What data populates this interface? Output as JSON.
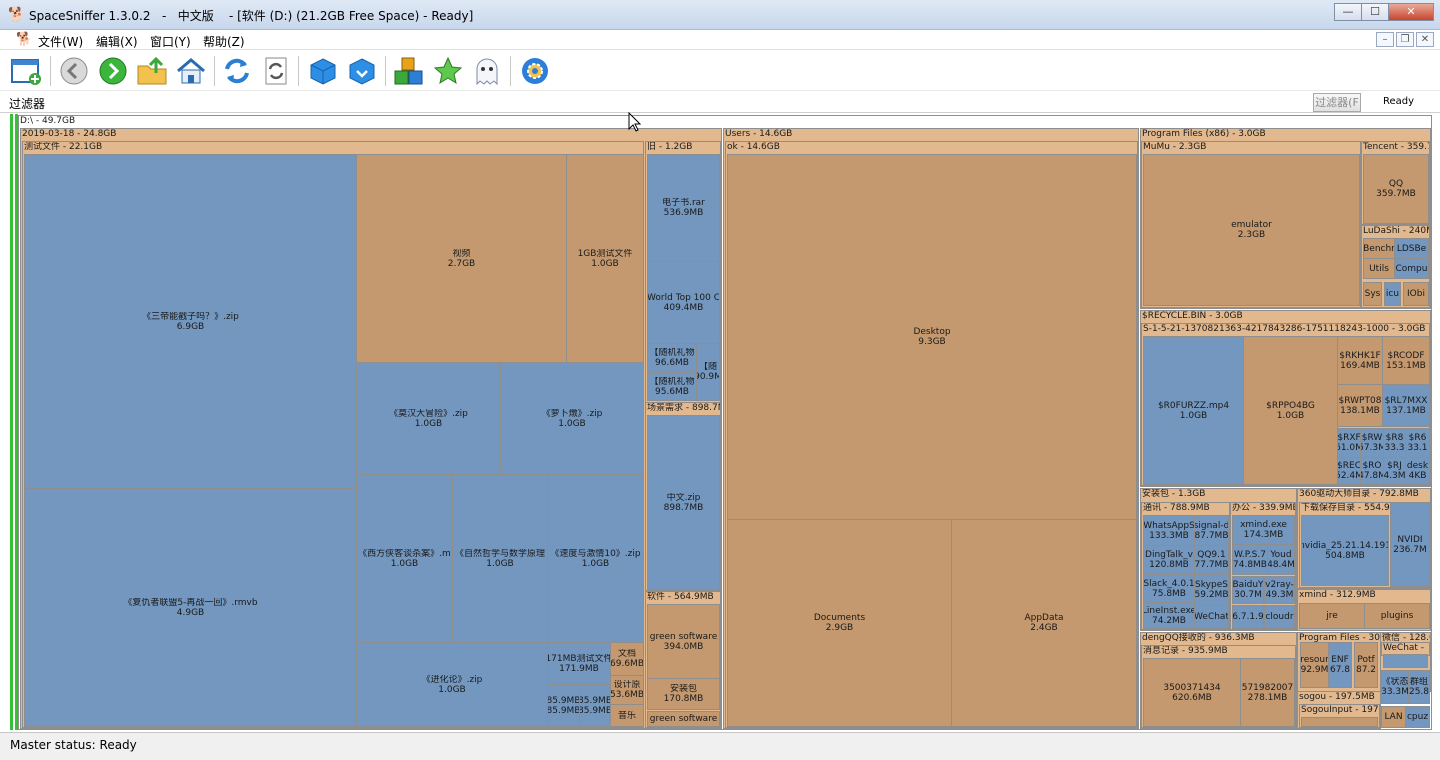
{
  "window": {
    "title": "SpaceSniffer 1.3.0.2   -   中文版    - [软件 (D:) (21.2GB Free Space) - Ready]",
    "icon": "sniffer-dog-icon",
    "buttons": {
      "minimize": "—",
      "maximize": "☐",
      "close": "✕"
    }
  },
  "menu": {
    "items": [
      "文件(W)",
      "编辑(X)",
      "窗口(Y)",
      "帮助(Z)"
    ],
    "mdi_buttons": {
      "minimize": "–",
      "restore": "❐",
      "close": "✕"
    }
  },
  "toolbar": {
    "buttons": [
      "new-view-icon",
      "back-icon",
      "forward-icon",
      "parent-folder-icon",
      "home-icon",
      "refresh-icon",
      "refresh-branch-icon",
      "zoom-in-icon",
      "zoom-out-icon",
      "tags-icon",
      "star-icon",
      "ghost-icon",
      "settings-icon"
    ]
  },
  "filter": {
    "label": "过滤器",
    "value": "",
    "button_label": "过滤器(F",
    "status": "Ready"
  },
  "colors": {
    "folder": "#c4996f",
    "file": "#7397bf",
    "header": "#e2b88e",
    "green": "#34c134"
  },
  "treemap": {
    "root": {
      "label": "D:\\ - 49.7GB"
    },
    "groups": {
      "g2019": "2019-03-18 - 24.8GB",
      "test": "测试文件 - 22.1GB",
      "old": "旧 - 1.2GB",
      "scene": "场景需求 - 898.7M",
      "soft": "软件 - 564.9MB",
      "users": "Users - 14.6GB",
      "ok": "ok - 14.6GB",
      "pf86": "Program Files (x86) - 3.0GB",
      "mumu": "MuMu - 2.3GB",
      "tencent": "Tencent - 359.7",
      "ludashi": "LuDaShi - 240M",
      "recycle": "$RECYCLE.BIN - 3.0GB",
      "sid": "S-1-5-21-1370821363-4217843286-1751118243-1000 - 3.0GB",
      "install": "安装包 - 1.3GB",
      "comm": "通讯 - 788.9MB",
      "office": "办公 - 339.9MB",
      "driver360": "360驱动大师目录 - 792.8MB",
      "dlcache": "下载保存目录 - 554.9",
      "xmind": "xmind - 312.9MB",
      "dengqq": "dengQQ接收的 - 936.3MB",
      "msglog": "消息记录 - 935.9MB",
      "progfiles": "Program Files - 30€",
      "wechatdir": "微信 - 128.6",
      "sogou": "sogou - 197.5MB",
      "sogouinput": "SogouInput - 197."
    },
    "items": {
      "sanguo": {
        "name": "《三帝能戳子吗？》.zip",
        "size": "6.9GB"
      },
      "fuchou": {
        "name": "《复仇者联盟5-再战一回》.rmvb",
        "size": "4.9GB"
      },
      "video": {
        "name": "视频",
        "size": "2.7GB"
      },
      "test1g": {
        "name": "1GB测试文件",
        "size": "1.0GB"
      },
      "hanhan": {
        "name": "《莫汉大冒险》.zip",
        "size": "1.0GB"
      },
      "luobo": {
        "name": "《萝卜燉》.zip",
        "size": "1.0GB"
      },
      "xifang": {
        "name": "《西方侠客谈杀案》.m",
        "size": "1.0GB"
      },
      "ziran": {
        "name": "《自然哲学与数学原理",
        "size": "1.0GB"
      },
      "sudu": {
        "name": "《速度与激情10》.zip",
        "size": "1.0GB"
      },
      "jinhua": {
        "name": "《进化论》.zip",
        "size": "1.0GB"
      },
      "t171": {
        "name": "171MB测试文件",
        "size": "171.9MB"
      },
      "wenjian": {
        "name": "文档",
        "size": "69.6MB"
      },
      "sheji": {
        "name": "设计原",
        "size": "53.6MB"
      },
      "a859a": {
        "name": "85.9MB",
        "size": "85.9MB"
      },
      "a859b": {
        "name": "85.9MB",
        "size": "85.9MB"
      },
      "yinyue": {
        "name": "音乐",
        "size": ""
      },
      "ebook": {
        "name": "电子书.rar",
        "size": "536.9MB"
      },
      "worldtop": {
        "name": "World Top 100 C",
        "size": "409.4MB"
      },
      "suiji1": {
        "name": "【随机礼物",
        "size": "96.6MB"
      },
      "suiji2": {
        "name": "【随机礼物",
        "size": "95.6MB"
      },
      "suiji3": {
        "name": "【随",
        "size": "90.9M"
      },
      "zhongwen": {
        "name": "中文.zip",
        "size": "898.7MB"
      },
      "greensoft": {
        "name": "green software",
        "size": "394.0MB"
      },
      "anzhuang": {
        "name": "安装包",
        "size": "170.8MB"
      },
      "greensoft2": {
        "name": "green software",
        "size": ""
      },
      "desktop": {
        "name": "Desktop",
        "size": "9.3GB"
      },
      "documents": {
        "name": "Documents",
        "size": "2.9GB"
      },
      "appdata": {
        "name": "AppData",
        "size": "2.4GB"
      },
      "emulator": {
        "name": "emulator",
        "size": "2.3GB"
      },
      "qq": {
        "name": "QQ",
        "size": "359.7MB"
      },
      "benchr": {
        "name": "Benchr",
        "size": ""
      },
      "ldsbe": {
        "name": "LDSBe",
        "size": ""
      },
      "utils": {
        "name": "Utils",
        "size": ""
      },
      "compu": {
        "name": "Compu",
        "size": ""
      },
      "sys": {
        "name": "Sys",
        "size": ""
      },
      "icu": {
        "name": "icu",
        "size": ""
      },
      "iobi": {
        "name": "IObi",
        "size": ""
      },
      "r0furzz": {
        "name": "$R0FURZZ.mp4",
        "size": "1.0GB"
      },
      "rppo4bg": {
        "name": "$RPPO4BG",
        "size": "1.0GB"
      },
      "rkhk": {
        "name": "$RKHK1F",
        "size": "169.4MB"
      },
      "rcodf": {
        "name": "$RCODF",
        "size": "153.1MB"
      },
      "rwpt": {
        "name": "$RWPT08",
        "size": "138.1MB"
      },
      "rl7mx": {
        "name": "$RL7MXX",
        "size": "137.1MB"
      },
      "rxf": {
        "name": "$RXF",
        "size": "61.0M"
      },
      "rw": {
        "name": "$RW",
        "size": "57.3M"
      },
      "r8": {
        "name": "$R8",
        "size": "33.3"
      },
      "r6": {
        "name": "$R6",
        "size": "33.1"
      },
      "rec": {
        "name": "$REC",
        "size": "52.4M"
      },
      "ro": {
        "name": "$RO",
        "size": "47.8M"
      },
      "rj": {
        "name": "$RJ",
        "size": "4.3M"
      },
      "desk": {
        "name": "desk",
        "size": "4KB"
      },
      "whatsapp": {
        "name": "WhatsAppS",
        "size": "133.3MB"
      },
      "signal": {
        "name": "signal-d",
        "size": "87.7MB"
      },
      "dingtalk": {
        "name": "DingTalk_v",
        "size": "120.8MB"
      },
      "qq91": {
        "name": "QQ9.1",
        "size": "77.7MB"
      },
      "slack": {
        "name": "Slack_4.0.1",
        "size": "75.8MB"
      },
      "skype": {
        "name": "SkypeS",
        "size": "59.2MB"
      },
      "lineinst": {
        "name": "LineInst.exe",
        "size": "74.2MB"
      },
      "wechat": {
        "name": "WeChat",
        "size": ""
      },
      "xmindexe": {
        "name": "xmind.exe",
        "size": "174.3MB"
      },
      "wps": {
        "name": "W.P.S.7",
        "size": "74.8MB"
      },
      "youdao": {
        "name": "Youd",
        "size": "48.4M"
      },
      "baidu": {
        "name": "BaiduY",
        "size": "30.7M"
      },
      "v2ray": {
        "name": "v2ray-",
        "size": "49.3M"
      },
      "v671": {
        "name": "6.7.1.9",
        "size": ""
      },
      "cloudr": {
        "name": "cloudr",
        "size": ""
      },
      "nvidia1": {
        "name": "nvidia_25.21.14.191",
        "size": "504.8MB"
      },
      "nvidia2": {
        "name": "NVIDI",
        "size": "236.7M"
      },
      "jre": {
        "name": "jre",
        "size": ""
      },
      "plugins": {
        "name": "plugins",
        "size": ""
      },
      "m35": {
        "name": "3500371434",
        "size": "620.6MB"
      },
      "m57": {
        "name": "571982007",
        "size": "278.1MB"
      },
      "resour": {
        "name": "resour",
        "size": "92.9M"
      },
      "enf": {
        "name": "ENF",
        "size": "67.8"
      },
      "potf": {
        "name": "Potf",
        "size": "87.2"
      },
      "wechatsub": {
        "name": "WeChat -",
        "size": ""
      },
      "xiaocheng": {
        "name": "《状态",
        "size": "33.3M"
      },
      "luntan": {
        "name": "群组",
        "size": "25.8"
      },
      "lan": {
        "name": "LAN",
        "size": ""
      },
      "cpuz": {
        "name": "cpuz",
        "size": ""
      }
    }
  },
  "status": {
    "text": "Master status: Ready"
  }
}
